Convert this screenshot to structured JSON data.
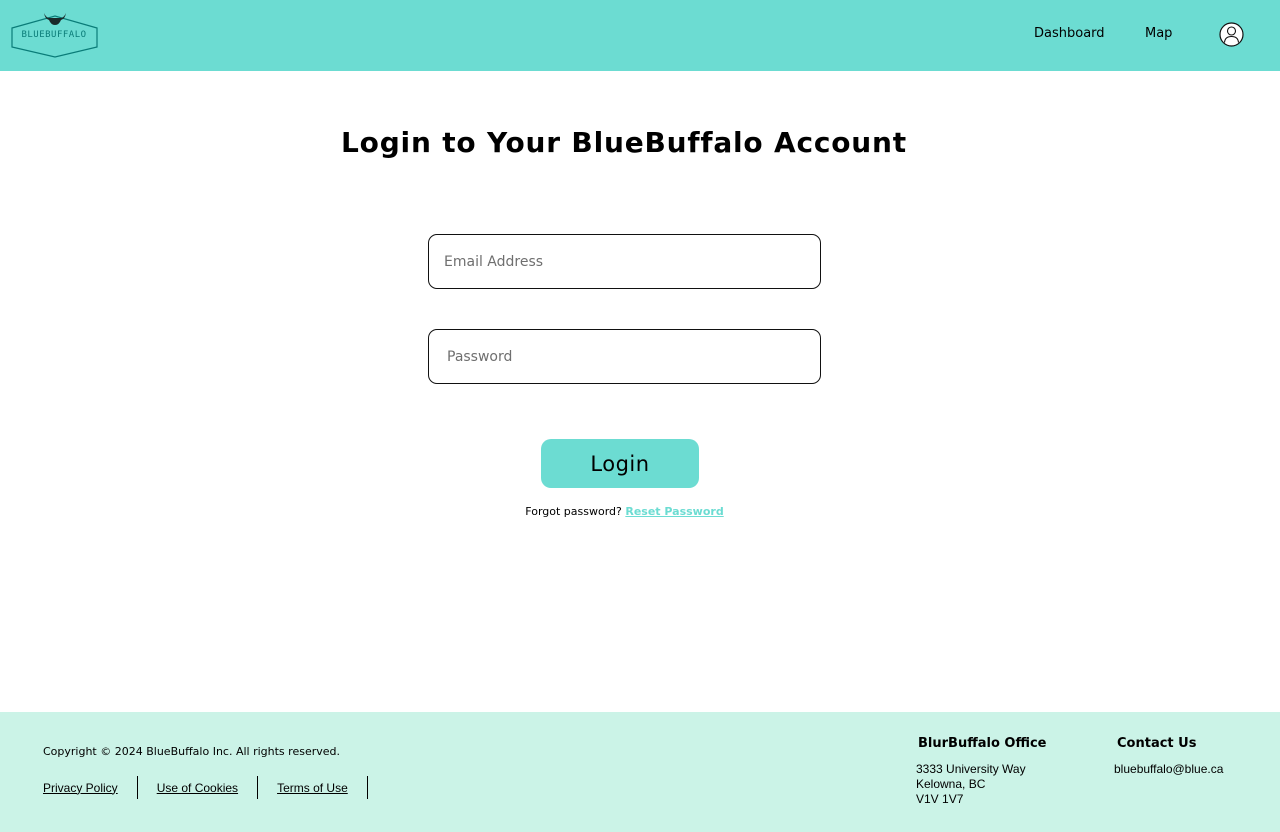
{
  "header": {
    "logo_text": "BLUEBUFFALO",
    "nav": [
      {
        "label": "Dashboard"
      },
      {
        "label": "Map"
      }
    ],
    "profile_icon": "user-icon"
  },
  "main": {
    "title": "Login to Your BlueBuffalo Account",
    "email": {
      "value": "",
      "placeholder": "Email Address"
    },
    "password": {
      "value": "",
      "placeholder": "Password"
    },
    "login_label": "Login",
    "forgot_text": "Forgot password?",
    "reset_label": "Reset Password"
  },
  "footer": {
    "copyright": "Copyright © 2024 BlueBuffalo Inc. All rights reserved.",
    "links": [
      {
        "label": "Privacy Policy"
      },
      {
        "label": "Use of Cookies"
      },
      {
        "label": "Terms of Use"
      }
    ],
    "office": {
      "title": "BlurBuffalo Office",
      "lines": [
        "3333 University Way",
        "Kelowna, BC",
        "V1V 1V7"
      ]
    },
    "contact": {
      "title": "Contact Us",
      "email": "bluebuffalo@blue.ca"
    }
  },
  "colors": {
    "accent": "#6cdcd2",
    "footer_bg": "#cbf3e7"
  }
}
